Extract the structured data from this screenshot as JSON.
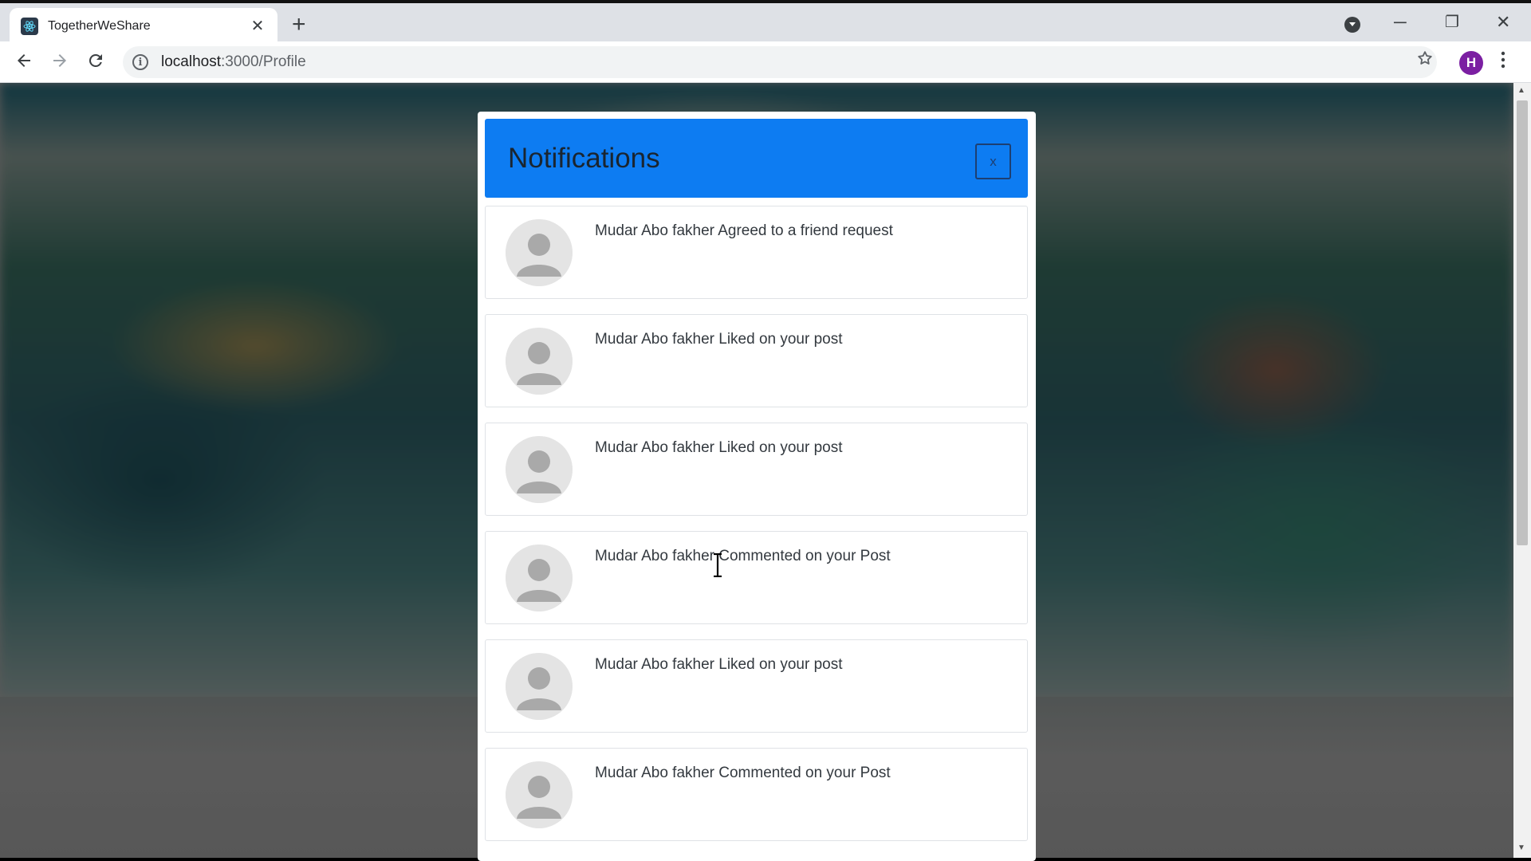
{
  "browser": {
    "tab_title": "TogetherWeShare",
    "tab_close": "✕",
    "new_tab": "+",
    "url_host": "localhost",
    "url_path": ":3000/Profile",
    "profile_initial": "H",
    "window_controls": {
      "minimize": "─",
      "restore": "❐",
      "close": "✕"
    }
  },
  "modal": {
    "title": "Notifications",
    "close_label": "x",
    "header_color": "#0d7cf2"
  },
  "notifications": [
    {
      "text": "Mudar Abo fakher Agreed to a friend request"
    },
    {
      "text": "Mudar Abo fakher Liked on your post"
    },
    {
      "text": "Mudar Abo fakher Liked on your post"
    },
    {
      "text": "Mudar Abo fakher Commented on your Post"
    },
    {
      "text": "Mudar Abo fakher Liked on your post"
    },
    {
      "text": "Mudar Abo fakher Commented on your Post"
    }
  ],
  "icons": {
    "back": "arrow-left-icon",
    "forward": "arrow-right-icon",
    "reload": "reload-icon",
    "info": "info-icon",
    "bookmark": "star-icon",
    "menu": "kebab-menu-icon",
    "avatar": "default-user-avatar-icon"
  }
}
